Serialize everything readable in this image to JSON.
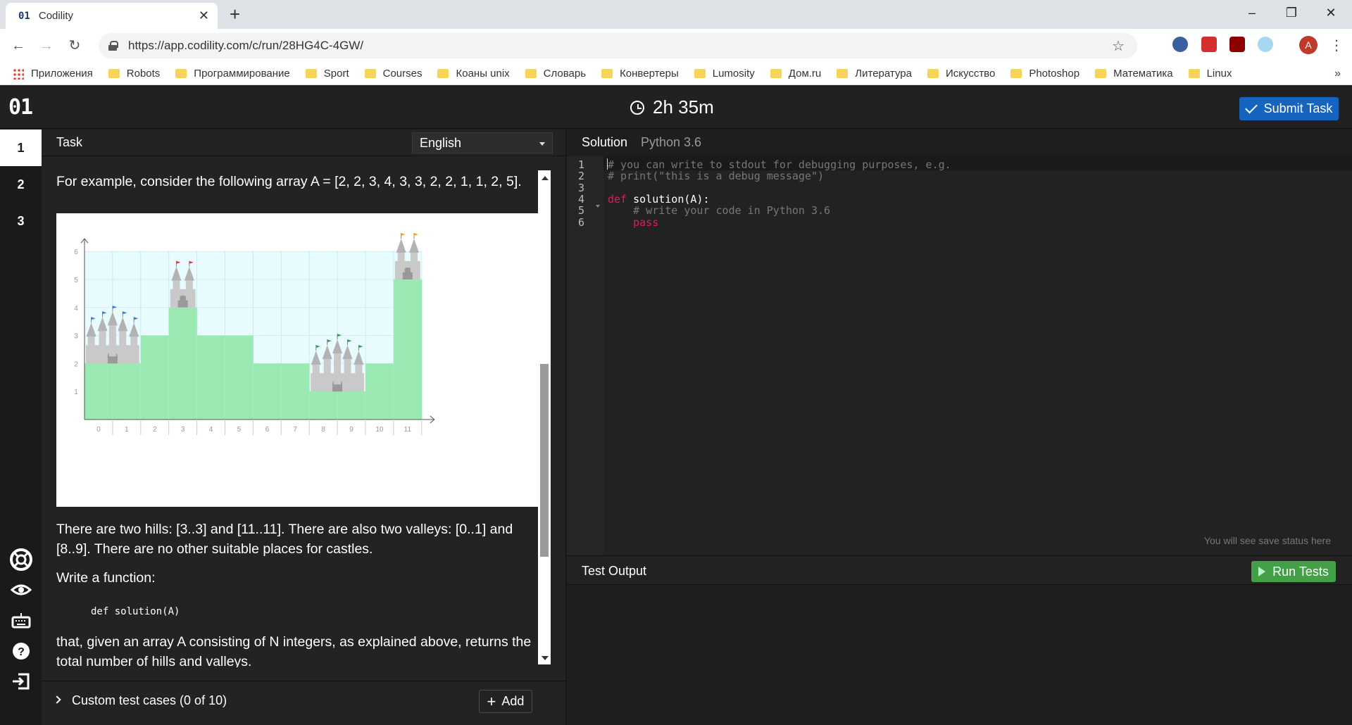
{
  "browser": {
    "tab_title": "Codility",
    "tab_favicon": "01",
    "url": "https://app.codility.com/c/run/28HG4C-4GW/",
    "avatar_letter": "A",
    "bookmarks": [
      "Приложения",
      "Robots",
      "Программирование",
      "Sport",
      "Courses",
      "Коаны unix",
      "Словарь",
      "Конвертеры",
      "Lumosity",
      "Дом.ru",
      "Литература",
      "Искусство",
      "Photoshop",
      "Математика",
      "Linux"
    ],
    "more": "»"
  },
  "header": {
    "logo": "01",
    "timer": "2h 35m",
    "submit_label": "Submit Task"
  },
  "rail": {
    "tasks": [
      "1",
      "2",
      "3"
    ],
    "icons": [
      "lifebuoy-icon",
      "eye-icon",
      "keyboard-icon",
      "help-icon",
      "exit-icon"
    ]
  },
  "task": {
    "title": "Task",
    "language": "English",
    "intro": "For example, consider the following array A = [2, 2, 3, 4, 3, 3, 2, 2, 1, 1, 2, 5].",
    "para_hills": "There are two hills: [3..3] and [11..11]. There are also two valleys: [0..1] and [8..9]. There are no other suitable places for castles.",
    "write_function": "Write a function:",
    "signature": "def solution(A)",
    "para_returns": "that, given an array A consisting of N integers, as explained above, returns the total number of hills and valleys.",
    "custom_tests_label": "Custom test cases (0 of 10)",
    "add_label": "Add"
  },
  "chart_data": {
    "type": "bar",
    "categories": [
      "0",
      "1",
      "2",
      "3",
      "4",
      "5",
      "6",
      "7",
      "8",
      "9",
      "10",
      "11"
    ],
    "values": [
      2,
      2,
      3,
      4,
      3,
      3,
      2,
      2,
      1,
      1,
      2,
      5
    ],
    "y_ticks": [
      "1",
      "2",
      "3",
      "4",
      "5",
      "6"
    ],
    "ylim": [
      0,
      6
    ],
    "castles": [
      {
        "span": [
          0,
          1
        ],
        "flag_color": "#3a7bd5"
      },
      {
        "span": [
          3,
          3
        ],
        "flag_color": "#e53935"
      },
      {
        "span": [
          8,
          9
        ],
        "flag_color": "#2e9d4f"
      },
      {
        "span": [
          11,
          11
        ],
        "flag_color": "#f5a623"
      }
    ],
    "colors": {
      "bar": "#9ae8b2",
      "sky": "#e8fbff",
      "castle": "#c9c9c9"
    }
  },
  "solution": {
    "tab_solution": "Solution",
    "tab_language": "Python 3.6",
    "code_lines": [
      {
        "n": "1",
        "text": "# you can write to stdout for debugging purposes, e.g."
      },
      {
        "n": "2",
        "text": "# print(\"this is a debug message\")"
      },
      {
        "n": "3",
        "text": ""
      },
      {
        "n": "4",
        "kw": "def",
        "text": " solution(A):"
      },
      {
        "n": "5",
        "text": "    # write your code in Python 3.6"
      },
      {
        "n": "6",
        "kw": "pass"
      }
    ],
    "save_status": "You will see save status here",
    "test_output_title": "Test Output",
    "run_tests_label": "Run Tests"
  }
}
